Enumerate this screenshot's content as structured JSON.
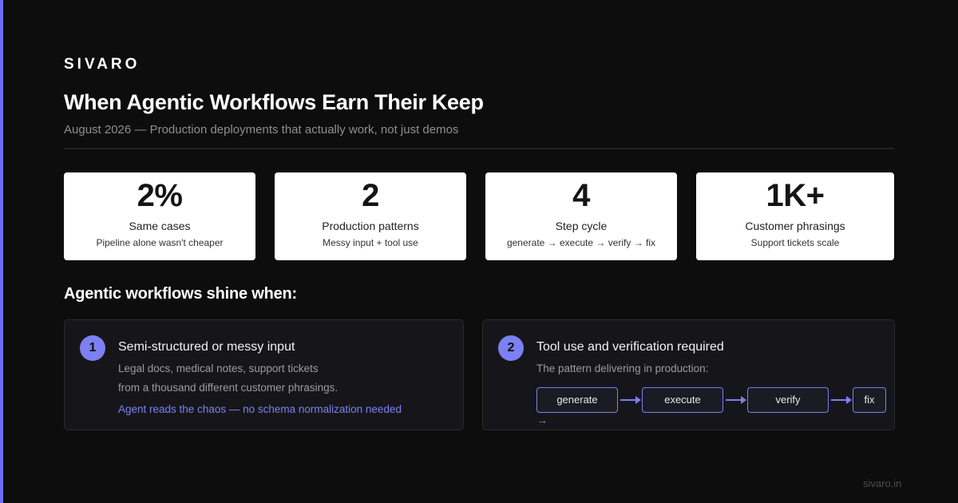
{
  "brand": "SIVARO",
  "title": "When Agentic Workflows Earn Their Keep",
  "subtitle": "August 2026 — Production deployments that actually work, not just demos",
  "stats": [
    {
      "value": "2%",
      "label": "Same cases",
      "desc": "Pipeline alone wasn't cheaper"
    },
    {
      "value": "2",
      "label": "Production patterns",
      "desc": "Messy input + tool use"
    },
    {
      "value": "4",
      "label": "Step cycle",
      "desc": "generate → execute → verify → fix"
    },
    {
      "value": "1K+",
      "label": "Customer phrasings",
      "desc": "Support tickets scale"
    }
  ],
  "section_title": "Agentic workflows shine when:",
  "cards": [
    {
      "number": "1",
      "title": "Semi-structured or messy input",
      "lines": [
        "Legal docs, medical notes, support tickets",
        "from a thousand different customer phrasings."
      ],
      "accent": "Agent reads the chaos — no schema normalization needed"
    },
    {
      "number": "2",
      "title": "Tool use and verification required",
      "lines": [
        "The pattern delivering in production:"
      ],
      "flow": [
        "generate",
        "execute",
        "verify",
        "fix"
      ],
      "overflow_arrow": "→"
    }
  ],
  "footer_url": "sivaro.in",
  "colors": {
    "accent": "#7c80f2",
    "background": "#0d0d0d",
    "card_bg": "#16161a",
    "stat_bg": "#ffffff"
  }
}
